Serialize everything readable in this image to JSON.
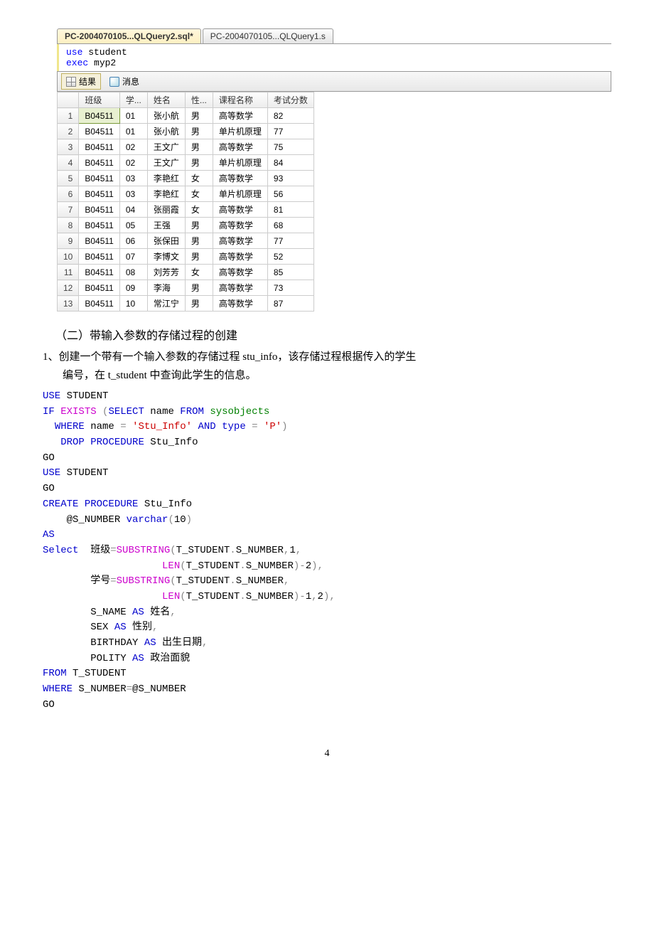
{
  "editor": {
    "tabs": [
      {
        "label": "PC-2004070105...QLQuery2.sql*",
        "active": true
      },
      {
        "label": "PC-2004070105...QLQuery1.s",
        "active": false
      }
    ],
    "code_lines": [
      [
        {
          "t": "kw",
          "v": "use"
        },
        {
          "t": "plain",
          "v": " student"
        }
      ],
      [
        {
          "t": "kw",
          "v": "exec"
        },
        {
          "t": "plain",
          "v": " myp2"
        }
      ]
    ],
    "result_tabs": {
      "results": "结果",
      "messages": "消息"
    },
    "columns": [
      "班级",
      "学...",
      "姓名",
      "性...",
      "课程名称",
      "考试分数"
    ],
    "rows": [
      [
        "B04511",
        "01",
        "张小航",
        "男",
        "高等数学",
        "82"
      ],
      [
        "B04511",
        "01",
        "张小航",
        "男",
        "单片机原理",
        "77"
      ],
      [
        "B04511",
        "02",
        "王文广",
        "男",
        "高等数学",
        "75"
      ],
      [
        "B04511",
        "02",
        "王文广",
        "男",
        "单片机原理",
        "84"
      ],
      [
        "B04511",
        "03",
        "李艳红",
        "女",
        "高等数学",
        "93"
      ],
      [
        "B04511",
        "03",
        "李艳红",
        "女",
        "单片机原理",
        "56"
      ],
      [
        "B04511",
        "04",
        "张丽霞",
        "女",
        "高等数学",
        "81"
      ],
      [
        "B04511",
        "05",
        "王强",
        "男",
        "高等数学",
        "68"
      ],
      [
        "B04511",
        "06",
        "张保田",
        "男",
        "高等数学",
        "77"
      ],
      [
        "B04511",
        "07",
        "李博文",
        "男",
        "高等数学",
        "52"
      ],
      [
        "B04511",
        "08",
        "刘芳芳",
        "女",
        "高等数学",
        "85"
      ],
      [
        "B04511",
        "09",
        "李海",
        "男",
        "高等数学",
        "73"
      ],
      [
        "B04511",
        "10",
        "常江宁",
        "男",
        "高等数学",
        "87"
      ]
    ]
  },
  "section": {
    "title": "（二）带输入参数的存储过程的创建",
    "para_line1": "1、创建一个带有一个输入参数的存储过程 stu_info，该存储过程根据传入的学生",
    "para_line2": "编号，在 t_student 中查询此学生的信息。"
  },
  "sql": [
    [
      {
        "t": "kw",
        "v": "USE"
      },
      {
        "t": "plain",
        "v": " STUDENT"
      }
    ],
    [
      {
        "t": "kw",
        "v": "IF"
      },
      {
        "t": "plain",
        "v": " "
      },
      {
        "t": "func",
        "v": "EXISTS"
      },
      {
        "t": "plain",
        "v": " "
      },
      {
        "t": "gray",
        "v": "("
      },
      {
        "t": "kw",
        "v": "SELECT"
      },
      {
        "t": "plain",
        "v": " name "
      },
      {
        "t": "kw",
        "v": "FROM"
      },
      {
        "t": "plain",
        "v": " "
      },
      {
        "t": "sys",
        "v": "sysobjects"
      }
    ],
    [
      {
        "t": "plain",
        "v": "  "
      },
      {
        "t": "kw",
        "v": "WHERE"
      },
      {
        "t": "plain",
        "v": " name "
      },
      {
        "t": "gray",
        "v": "="
      },
      {
        "t": "plain",
        "v": " "
      },
      {
        "t": "str",
        "v": "'Stu_Info'"
      },
      {
        "t": "plain",
        "v": " "
      },
      {
        "t": "kw",
        "v": "AND"
      },
      {
        "t": "plain",
        "v": " "
      },
      {
        "t": "kw",
        "v": "type"
      },
      {
        "t": "plain",
        "v": " "
      },
      {
        "t": "gray",
        "v": "="
      },
      {
        "t": "plain",
        "v": " "
      },
      {
        "t": "str",
        "v": "'P'"
      },
      {
        "t": "gray",
        "v": ")"
      }
    ],
    [
      {
        "t": "plain",
        "v": "   "
      },
      {
        "t": "kw",
        "v": "DROP"
      },
      {
        "t": "plain",
        "v": " "
      },
      {
        "t": "kw",
        "v": "PROCEDURE"
      },
      {
        "t": "plain",
        "v": " Stu_Info"
      }
    ],
    [
      {
        "t": "plain",
        "v": "GO"
      }
    ],
    [
      {
        "t": "kw",
        "v": "USE"
      },
      {
        "t": "plain",
        "v": " STUDENT"
      }
    ],
    [
      {
        "t": "plain",
        "v": "GO"
      }
    ],
    [
      {
        "t": "kw",
        "v": "CREATE"
      },
      {
        "t": "plain",
        "v": " "
      },
      {
        "t": "kw",
        "v": "PROCEDURE"
      },
      {
        "t": "plain",
        "v": " Stu_Info"
      }
    ],
    [
      {
        "t": "plain",
        "v": "    @S_NUMBER "
      },
      {
        "t": "kw",
        "v": "varchar"
      },
      {
        "t": "gray",
        "v": "("
      },
      {
        "t": "plain",
        "v": "10"
      },
      {
        "t": "gray",
        "v": ")"
      }
    ],
    [
      {
        "t": "kw",
        "v": "AS"
      }
    ],
    [
      {
        "t": "kw",
        "v": "Select"
      },
      {
        "t": "plain",
        "v": "  班级"
      },
      {
        "t": "gray",
        "v": "="
      },
      {
        "t": "func",
        "v": "SUBSTRING"
      },
      {
        "t": "gray",
        "v": "("
      },
      {
        "t": "plain",
        "v": "T_STUDENT"
      },
      {
        "t": "gray",
        "v": "."
      },
      {
        "t": "plain",
        "v": "S_NUMBER"
      },
      {
        "t": "gray",
        "v": ","
      },
      {
        "t": "plain",
        "v": "1"
      },
      {
        "t": "gray",
        "v": ","
      }
    ],
    [
      {
        "t": "plain",
        "v": "                    "
      },
      {
        "t": "func",
        "v": "LEN"
      },
      {
        "t": "gray",
        "v": "("
      },
      {
        "t": "plain",
        "v": "T_STUDENT"
      },
      {
        "t": "gray",
        "v": "."
      },
      {
        "t": "plain",
        "v": "S_NUMBER"
      },
      {
        "t": "gray",
        "v": ")-"
      },
      {
        "t": "plain",
        "v": "2"
      },
      {
        "t": "gray",
        "v": "),"
      }
    ],
    [
      {
        "t": "plain",
        "v": "        学号"
      },
      {
        "t": "gray",
        "v": "="
      },
      {
        "t": "func",
        "v": "SUBSTRING"
      },
      {
        "t": "gray",
        "v": "("
      },
      {
        "t": "plain",
        "v": "T_STUDENT"
      },
      {
        "t": "gray",
        "v": "."
      },
      {
        "t": "plain",
        "v": "S_NUMBER"
      },
      {
        "t": "gray",
        "v": ","
      }
    ],
    [
      {
        "t": "plain",
        "v": "                    "
      },
      {
        "t": "func",
        "v": "LEN"
      },
      {
        "t": "gray",
        "v": "("
      },
      {
        "t": "plain",
        "v": "T_STUDENT"
      },
      {
        "t": "gray",
        "v": "."
      },
      {
        "t": "plain",
        "v": "S_NUMBER"
      },
      {
        "t": "gray",
        "v": ")-"
      },
      {
        "t": "plain",
        "v": "1"
      },
      {
        "t": "gray",
        "v": ","
      },
      {
        "t": "plain",
        "v": "2"
      },
      {
        "t": "gray",
        "v": "),"
      }
    ],
    [
      {
        "t": "plain",
        "v": "        S_NAME "
      },
      {
        "t": "kw",
        "v": "AS"
      },
      {
        "t": "plain",
        "v": " 姓名"
      },
      {
        "t": "gray",
        "v": ","
      }
    ],
    [
      {
        "t": "plain",
        "v": "        SEX "
      },
      {
        "t": "kw",
        "v": "AS"
      },
      {
        "t": "plain",
        "v": " 性别"
      },
      {
        "t": "gray",
        "v": ","
      }
    ],
    [
      {
        "t": "plain",
        "v": "        BIRTHDAY "
      },
      {
        "t": "kw",
        "v": "AS"
      },
      {
        "t": "plain",
        "v": " 出生日期"
      },
      {
        "t": "gray",
        "v": ","
      }
    ],
    [
      {
        "t": "plain",
        "v": "        POLITY "
      },
      {
        "t": "kw",
        "v": "AS"
      },
      {
        "t": "plain",
        "v": " 政治面貌"
      }
    ],
    [
      {
        "t": "kw",
        "v": "FROM"
      },
      {
        "t": "plain",
        "v": " T_STUDENT"
      }
    ],
    [
      {
        "t": "kw",
        "v": "WHERE"
      },
      {
        "t": "plain",
        "v": " S_NUMBER"
      },
      {
        "t": "gray",
        "v": "="
      },
      {
        "t": "plain",
        "v": "@S_NUMBER"
      }
    ],
    [
      {
        "t": "plain",
        "v": "GO"
      }
    ]
  ],
  "page_number": "4"
}
